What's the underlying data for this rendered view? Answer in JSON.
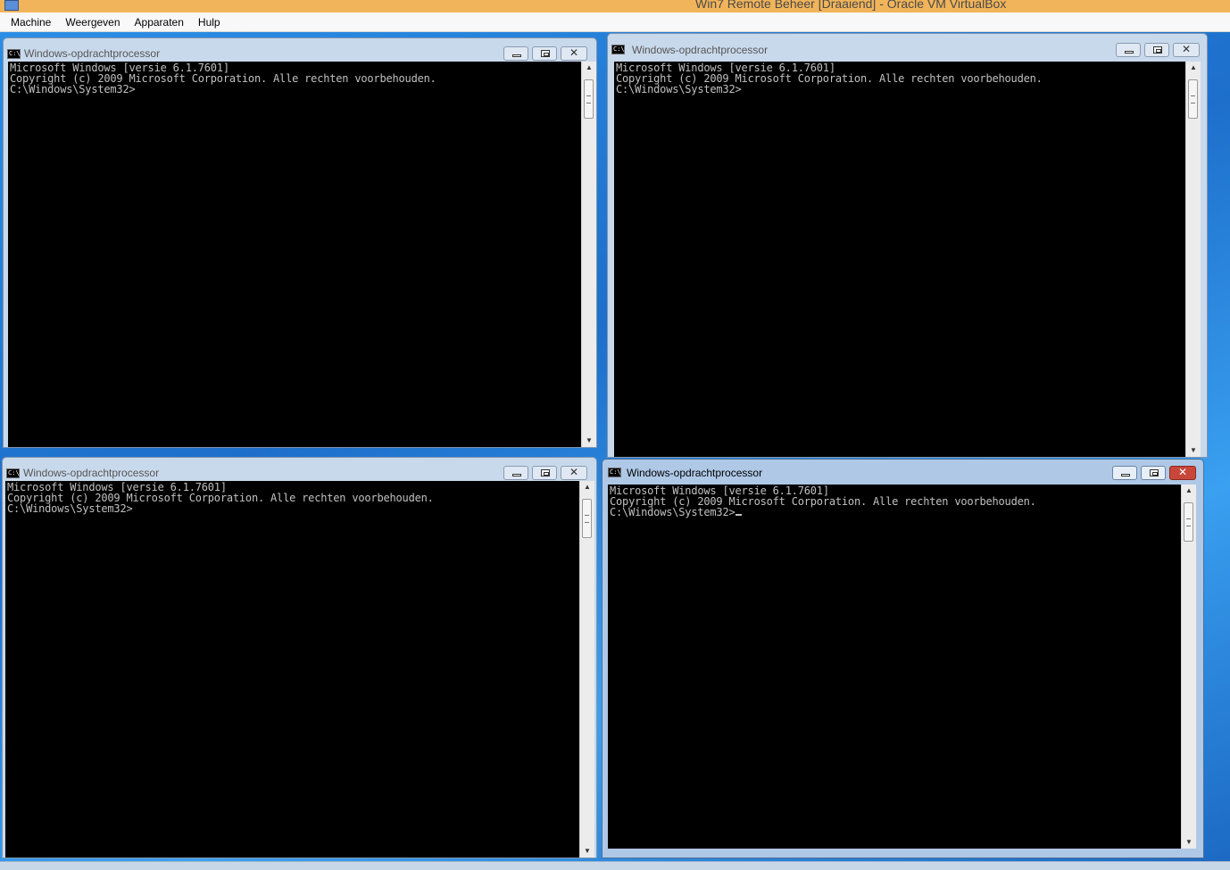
{
  "host": {
    "title": "Win7 Remote Beheer [Draaiend] - Oracle VM VirtualBox",
    "menu": [
      "Machine",
      "Weergeven",
      "Apparaten",
      "Hulp"
    ]
  },
  "windows": [
    {
      "title": "Windows-opdrachtprocessor",
      "lines": [
        "Microsoft Windows [versie 6.1.7601]",
        "Copyright (c) 2009 Microsoft Corporation. Alle rechten voorbehouden.",
        "",
        "C:\\Windows\\System32>"
      ],
      "active": false
    },
    {
      "title": "Windows-opdrachtprocessor",
      "lines": [
        "Microsoft Windows [versie 6.1.7601]",
        "Copyright (c) 2009 Microsoft Corporation. Alle rechten voorbehouden.",
        "",
        "C:\\Windows\\System32>"
      ],
      "active": false
    },
    {
      "title": "Windows-opdrachtprocessor",
      "lines": [
        "Microsoft Windows [versie 6.1.7601]",
        "Copyright (c) 2009 Microsoft Corporation. Alle rechten voorbehouden.",
        "",
        "C:\\Windows\\System32>"
      ],
      "active": false
    },
    {
      "title": "Windows-opdrachtprocessor",
      "lines": [
        "Microsoft Windows [versie 6.1.7601]",
        "Copyright (c) 2009 Microsoft Corporation. Alle rechten voorbehouden.",
        "",
        "C:\\Windows\\System32>"
      ],
      "active": true
    }
  ],
  "colors": {
    "host_titlebar": "#f1b45a",
    "console_bg": "#000000",
    "console_text": "#c0c0c0",
    "close_active": "#c8463a",
    "desktop": "#2a7fd4"
  },
  "icons": {
    "window": "cmd-icon",
    "minimize": "minimize-icon",
    "maximize": "maximize-icon",
    "close": "close-icon",
    "scroll_up": "scroll-up-arrow-icon",
    "scroll_down": "scroll-down-arrow-icon"
  }
}
